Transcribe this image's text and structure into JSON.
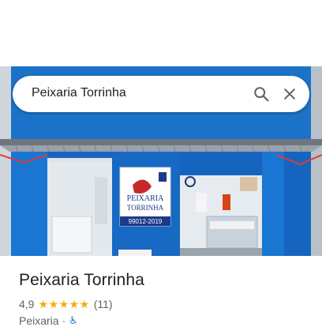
{
  "search": {
    "query": "Peixaria Torrinha"
  },
  "place": {
    "name": "Peixaria Torrinha",
    "rating": "4,9",
    "stars": "★★★★★",
    "review_count": "(11)",
    "category": "Peixaria",
    "separator": "·",
    "accessibility_icon": "wheelchair-icon"
  },
  "photo": {
    "sign_line1": "PEIXARIA",
    "sign_line2": "TORRINHA",
    "sign_phone": "99012-2019",
    "colors": {
      "wall": "#1d6fc2",
      "roof": "#8a9099",
      "interior": "#e9eef2"
    }
  }
}
